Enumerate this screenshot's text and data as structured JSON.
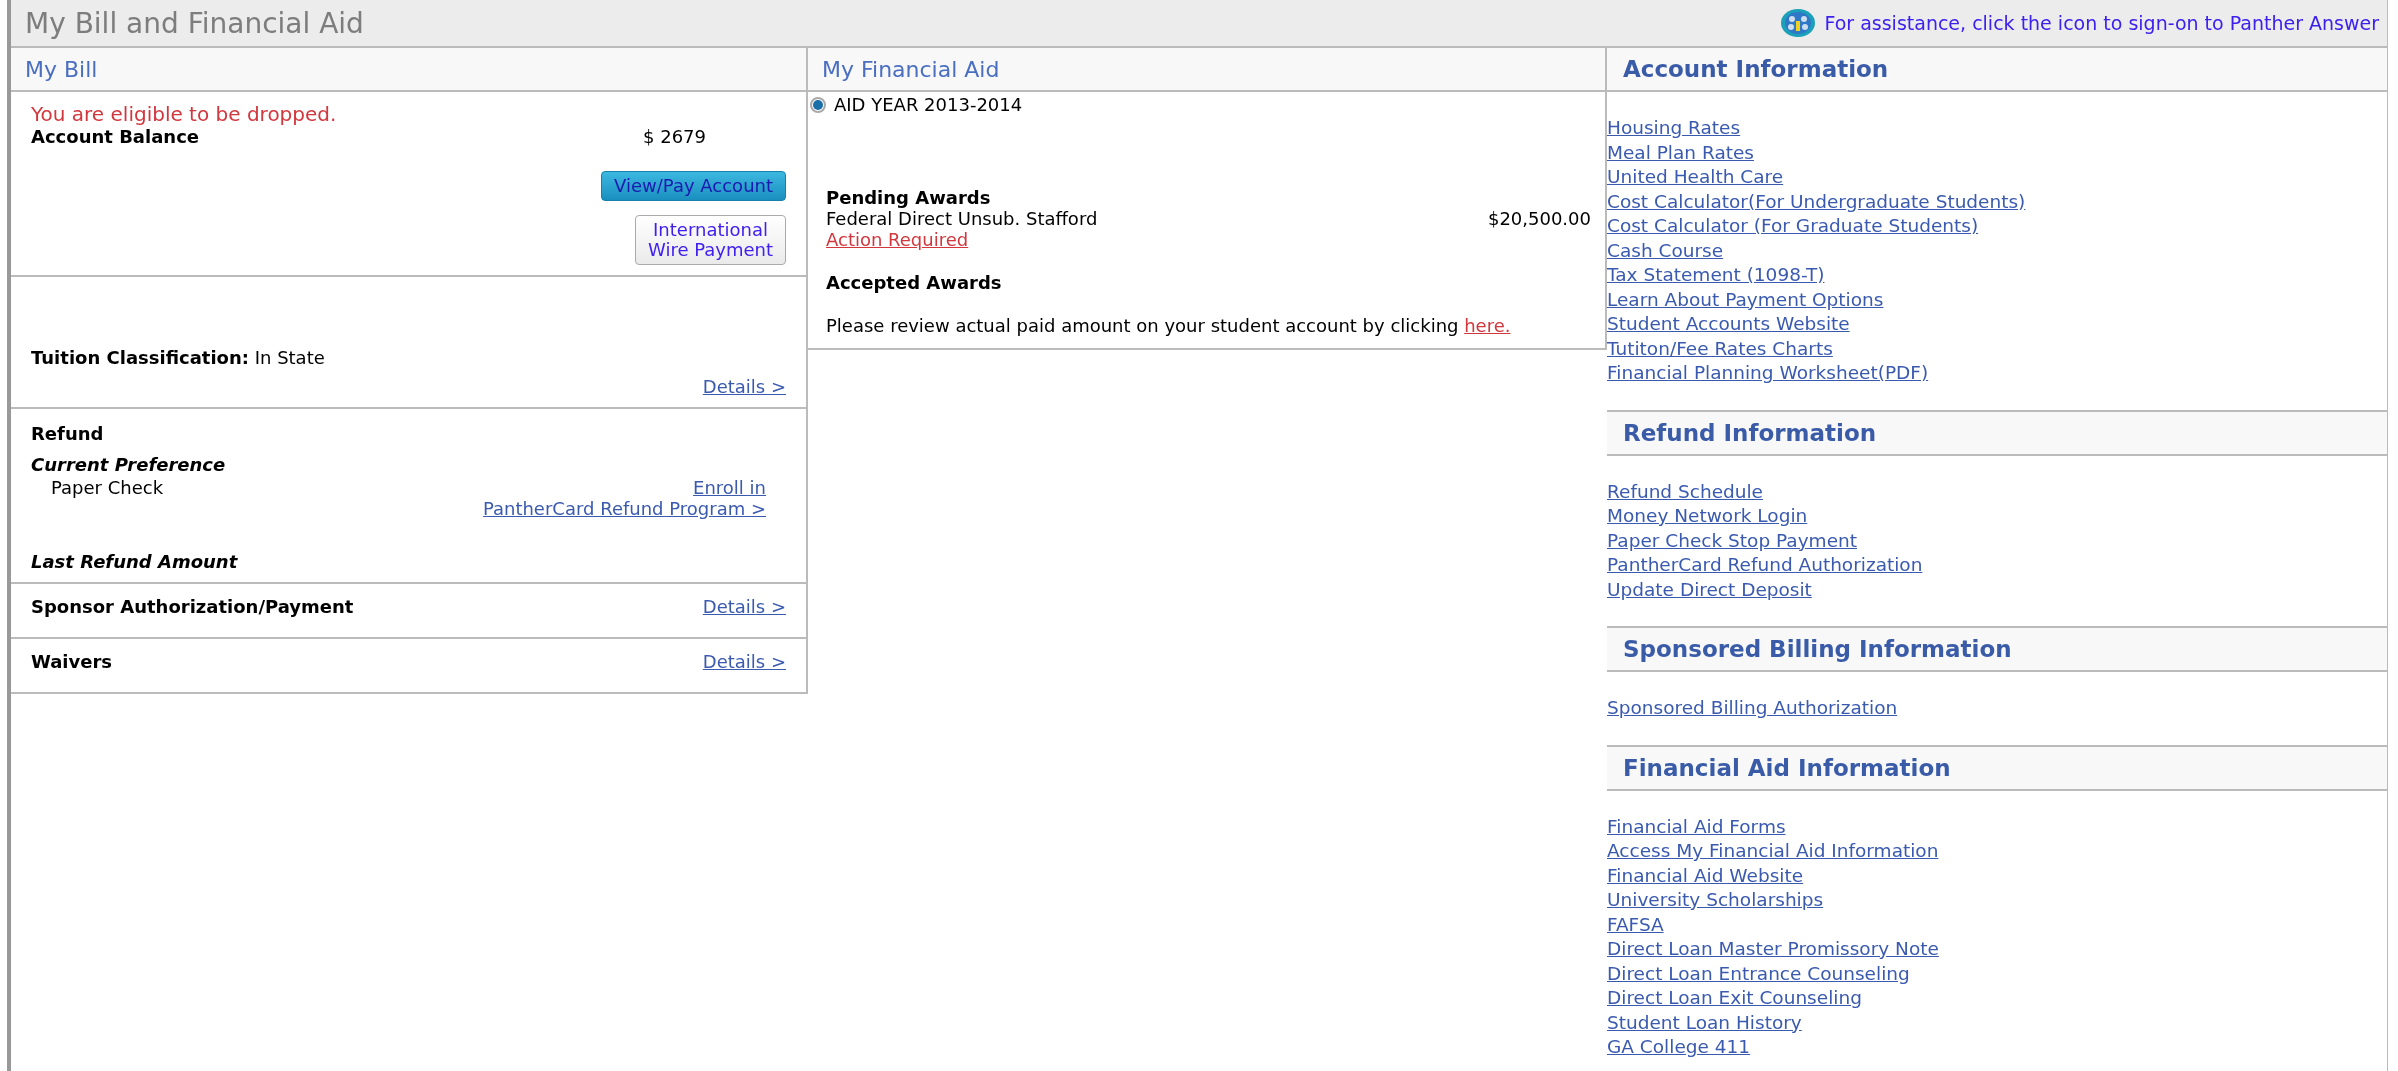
{
  "page_title": "My Bill and Financial Aid",
  "assistance": {
    "text": "For assistance, click the icon to sign-on to Panther Answer"
  },
  "my_bill": {
    "title": "My Bill",
    "alert": "You are eligible to be dropped.",
    "balance_label": "Account Balance",
    "balance": "$ 2679",
    "buttons": [
      {
        "label": "View/Pay Account",
        "kind": "primary"
      },
      {
        "label": "International\nWire Payment",
        "kind": "secondary"
      }
    ],
    "tuition": {
      "label": "Tuition Classification:",
      "value": "In State",
      "link": "Details >"
    },
    "refund": {
      "title": "Refund",
      "preference_label": "Current Preference",
      "preference": "Paper Check",
      "enroll_link": "Enroll in",
      "program_link": "PantherCard Refund Program >",
      "last_label": "Last Refund Amount"
    },
    "rows": [
      {
        "label": "Sponsor Authorization/Payment",
        "link": "Details >"
      },
      {
        "label": "Waivers",
        "link": "Details >"
      }
    ]
  },
  "financial_aid": {
    "title": "My Financial Aid",
    "aid_years": [
      {
        "label": "AID YEAR 2013-2014",
        "selected": true
      }
    ],
    "pending_title": "Pending Awards",
    "pending": [
      {
        "name": "Federal Direct Unsub. Stafford",
        "amount": "$20,500.00",
        "action": "Action Required"
      }
    ],
    "accepted_title": "Accepted Awards",
    "note": "Please review actual paid amount on your student account by clicking",
    "note_link": "here."
  },
  "sections": [
    {
      "title": "Account Information",
      "links": [
        "Housing Rates",
        "Meal Plan Rates",
        "United Health Care",
        "Cost Calculator(For Undergraduate Students)",
        "Cost Calculator (For Graduate Students)",
        "Cash Course",
        "Tax Statement (1098-T)",
        "Learn About Payment Options",
        "Student Accounts Website",
        "Tutiton/Fee Rates Charts",
        "Financial Planning Worksheet(PDF)"
      ]
    },
    {
      "title": "Refund Information",
      "links": [
        "Refund Schedule",
        "Money Network Login",
        "Paper Check Stop Payment",
        "PantherCard Refund Authorization",
        "Update Direct Deposit"
      ]
    },
    {
      "title": "Sponsored Billing Information",
      "links": [
        "Sponsored Billing Authorization"
      ]
    },
    {
      "title": "Financial Aid Information",
      "links": [
        "Financial Aid Forms",
        "Access My Financial Aid Information",
        "Financial Aid Website",
        "University Scholarships",
        "FAFSA",
        "Direct Loan Master Promissory Note",
        "Direct Loan Entrance Counseling",
        "Direct Loan Exit Counseling",
        "Student Loan History",
        "GA College 411"
      ]
    }
  ]
}
